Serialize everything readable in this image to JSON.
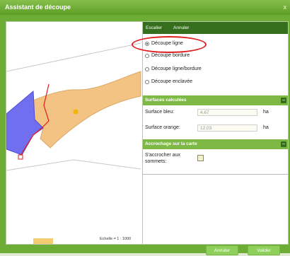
{
  "window": {
    "title": "Assistant de découpe",
    "close_label": "x"
  },
  "map": {
    "scale_label": "Echelle = 1 : 1000"
  },
  "tabs": [
    {
      "label": "Escalier"
    },
    {
      "label": "Annuler"
    }
  ],
  "cut_modes": {
    "options": [
      {
        "label": "Découpe ligne",
        "checked": true
      },
      {
        "label": "Découpe bordure",
        "checked": false
      },
      {
        "label": "Découpe ligne/bordure",
        "checked": false
      },
      {
        "label": "Découpe enclavée",
        "checked": false
      }
    ]
  },
  "surfaces": {
    "title": "Surfaces calculées",
    "blue_label": "Surface bleu:",
    "blue_value": "4.67",
    "blue_unit": "ha",
    "orange_label": "Surface orange:",
    "orange_value": "12.03",
    "orange_unit": "ha"
  },
  "snapping": {
    "title": "Accrochage sur la carte",
    "label": "S'accrocher aux sommets:"
  },
  "buttons": {
    "cancel": "Annuler",
    "validate": "Valider"
  },
  "colors": {
    "accent": "#6dac35",
    "header_dark": "#356f1e",
    "annotation": "#e21e1e"
  }
}
